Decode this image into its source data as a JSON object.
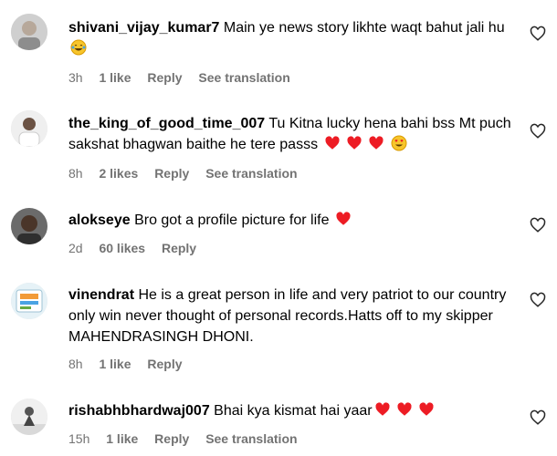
{
  "comments": [
    {
      "username": "shivani_vijay_kumar7",
      "text": "Main ye news story likhte waqt bahut jali hu",
      "emojis": [
        "laughing-tears"
      ],
      "time": "3h",
      "likes": "1 like",
      "reply": "Reply",
      "translation": "See translation"
    },
    {
      "username": "the_king_of_good_time_007",
      "text": "Tu Kitna lucky hena bahi bss Mt puch sakshat bhagwan baithe he tere passs",
      "emojis": [
        "red-heart",
        "red-heart",
        "red-heart",
        "heart-eyes"
      ],
      "time": "8h",
      "likes": "2 likes",
      "reply": "Reply",
      "translation": "See translation"
    },
    {
      "username": "alokseye",
      "text": "Bro got a profile picture for life",
      "emojis": [
        "red-heart"
      ],
      "time": "2d",
      "likes": "60 likes",
      "reply": "Reply"
    },
    {
      "username": "vinendrat",
      "text": "He is a great person in life and very patriot to our country only win never thought of personal records.Hatts off to my skipper MAHENDRASINGH DHONI.",
      "emojis": [],
      "time": "8h",
      "likes": "1 like",
      "reply": "Reply"
    },
    {
      "username": "rishabhbhardwaj007",
      "text": "Bhai kya kismat hai yaar",
      "emojis": [
        "red-heart",
        "red-heart",
        "red-heart"
      ],
      "time": "15h",
      "likes": "1 like",
      "reply": "Reply",
      "translation": "See translation"
    }
  ],
  "colors": {
    "meta": "#737373",
    "heart": "#ed1c24",
    "text": "#000000"
  }
}
